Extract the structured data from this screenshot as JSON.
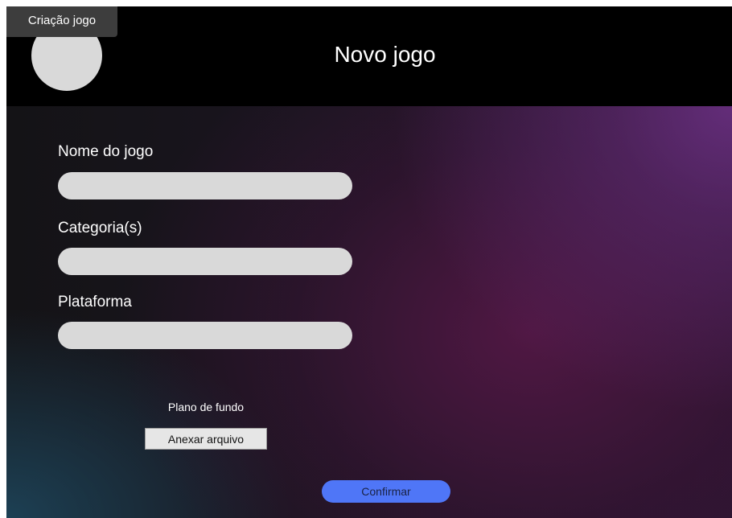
{
  "frame": {
    "label": "Criação jogo"
  },
  "header": {
    "title": "Novo jogo"
  },
  "form": {
    "fields": [
      {
        "label": "Nome do jogo",
        "value": ""
      },
      {
        "label": "Categoria(s)",
        "value": ""
      },
      {
        "label": "Plataforma",
        "value": ""
      }
    ],
    "background": {
      "label": "Plano de fundo",
      "attach_label": "Anexar arquivo"
    },
    "confirm_label": "Confirmar"
  },
  "colors": {
    "header_bg": "#000000",
    "input_bg": "#d9d9d9",
    "confirm_bg": "#4f76f7",
    "accent_purple": "#662e7d"
  },
  "icons": {
    "avatar": "avatar-placeholder-circle"
  }
}
